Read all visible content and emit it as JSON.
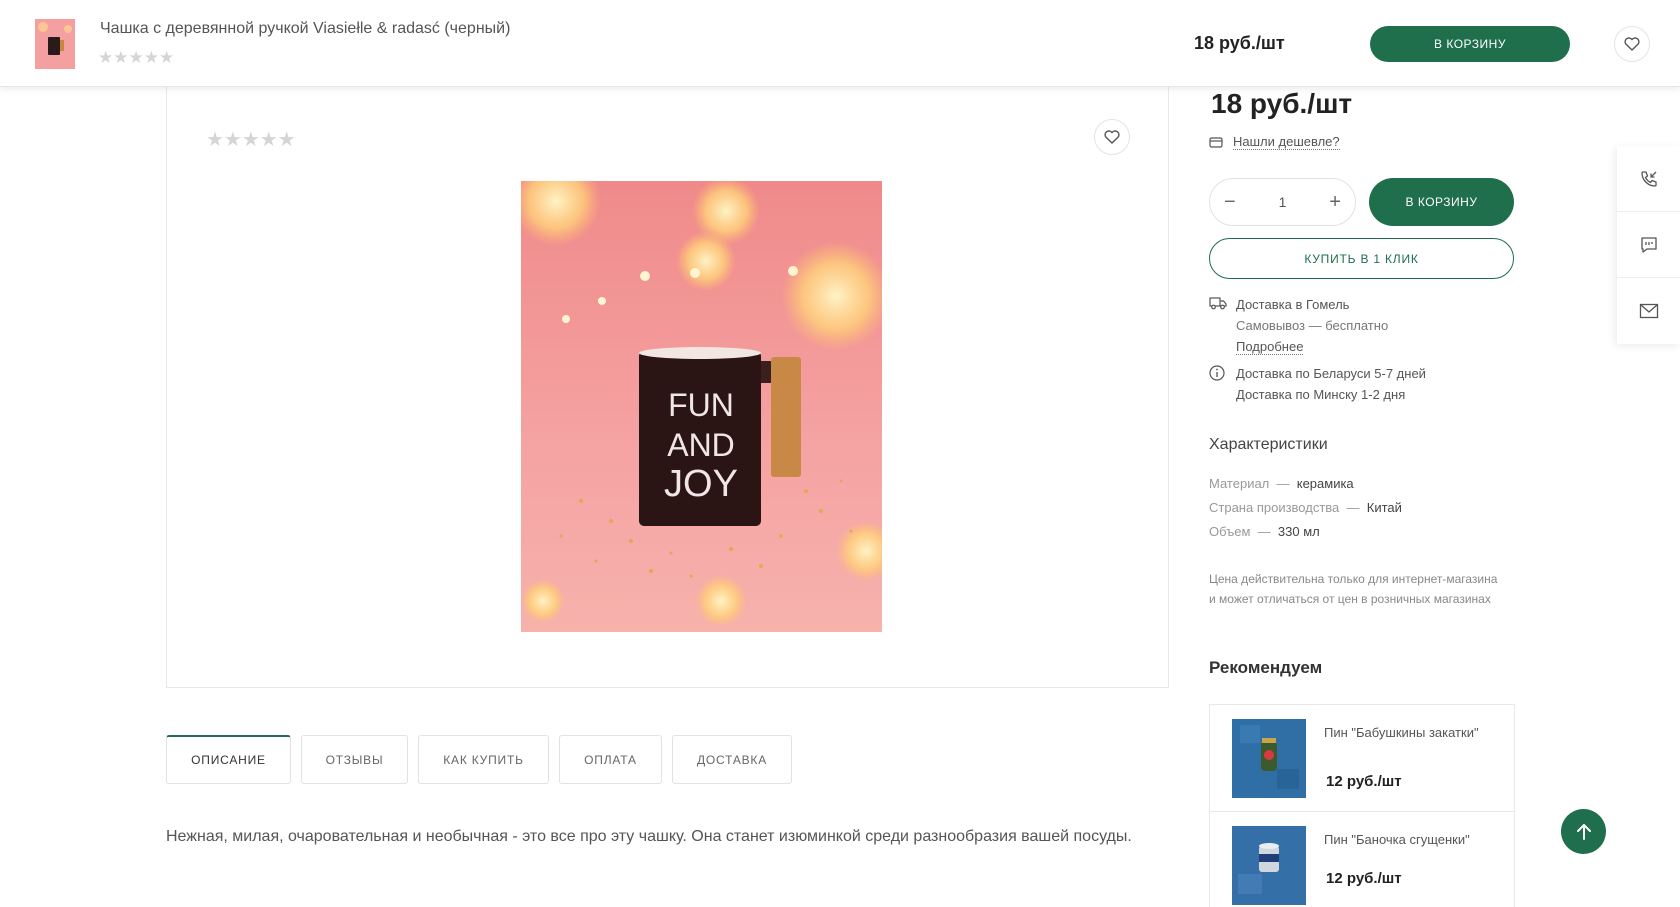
{
  "sticky_bar": {
    "title": "Чашка с деревянной ручкой Viasiełle & radasć (черный)",
    "stars": "★★★★★",
    "price": "18 руб./шт",
    "cart_label": "В КОРЗИНУ",
    "favorite_icon": "heart-icon"
  },
  "gallery": {
    "stars": "★★★★★",
    "favorite_icon": "heart-icon",
    "mug_text": [
      "FUN",
      "AND",
      "JOY"
    ]
  },
  "tabs": [
    {
      "label": "ОПИСАНИЕ",
      "active": true
    },
    {
      "label": "ОТЗЫВЫ"
    },
    {
      "label": "КАК КУПИТЬ"
    },
    {
      "label": "ОПЛАТА"
    },
    {
      "label": "ДОСТАВКА"
    }
  ],
  "description": "Нежная, милая, очаровательная и необычная - это все про эту чашку. Она станет изюминкой среди разнообразия вашей посуды.",
  "buy_panel": {
    "price": "18 руб./шт",
    "found_cheaper": "Нашли дешевле?",
    "quantity": "1",
    "cart_label": "В КОРЗИНУ",
    "one_click_label": "КУПИТЬ В 1 КЛИК",
    "delivery_title": "Доставка в Гомель",
    "pickup": "Самовывоз — бесплатно",
    "more_link": "Подробнее",
    "delivery_by": "Доставка по Беларуси 5-7 дней",
    "delivery_minsk": "Доставка по Минску 1-2 дня"
  },
  "characteristics": {
    "heading": "Характеристики",
    "items": [
      {
        "key": "Материал",
        "sep": "—",
        "value": "керамика"
      },
      {
        "key": "Страна производства",
        "sep": "—",
        "value": "Китай"
      },
      {
        "key": "Объем",
        "sep": "—",
        "value": "330 мл"
      }
    ]
  },
  "price_note": "Цена действительна только для интернет-магазина и может отличаться от цен в розничных магазинах",
  "recommend": {
    "heading": "Рекомендуем",
    "items": [
      {
        "name": "Пин \"Бабушкины закатки\"",
        "price": "12 руб./шт"
      },
      {
        "name": "Пин \"Баночка сгущенки\"",
        "price": "12 руб./шт"
      }
    ]
  },
  "side_widget": {
    "icons": [
      "phone-call-icon",
      "chat-icon",
      "mail-icon"
    ]
  },
  "scroll_top_icon": "arrow-up-icon"
}
